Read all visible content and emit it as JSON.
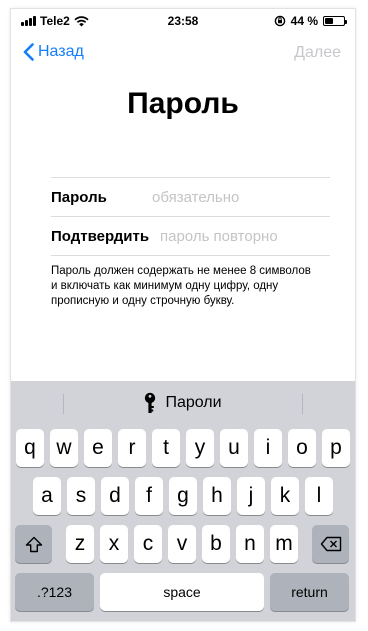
{
  "status": {
    "carrier": "Tele2",
    "time": "23:58",
    "battery": "44 %",
    "battery_level": 0.44
  },
  "nav": {
    "back_label": "Назад",
    "next_label": "Далее"
  },
  "title": "Пароль",
  "form": {
    "password_label": "Пароль",
    "password_placeholder": "обязательно",
    "confirm_label": "Подтвердить",
    "confirm_placeholder": "пароль повторно"
  },
  "hint": "Пароль должен содержать не менее 8 символов и включать как минимум одну цифру, одну прописную и одну строчную букву.",
  "keyboard": {
    "suggestion": "Пароли",
    "row1": [
      "q",
      "w",
      "e",
      "r",
      "t",
      "y",
      "u",
      "i",
      "o",
      "p"
    ],
    "row2": [
      "a",
      "s",
      "d",
      "f",
      "g",
      "h",
      "j",
      "k",
      "l"
    ],
    "row3": [
      "z",
      "x",
      "c",
      "v",
      "b",
      "n",
      "m"
    ],
    "numbers_label": ".?123",
    "space_label": "space",
    "return_label": "return"
  },
  "colors": {
    "accent": "#147efb",
    "disabled": "#c7c7cc",
    "keyboard_bg": "#d1d3d9"
  },
  "icons": [
    "wifi-icon",
    "lock-rotation-icon",
    "battery-icon",
    "back-chevron-icon",
    "key-icon",
    "shift-icon",
    "delete-icon"
  ]
}
